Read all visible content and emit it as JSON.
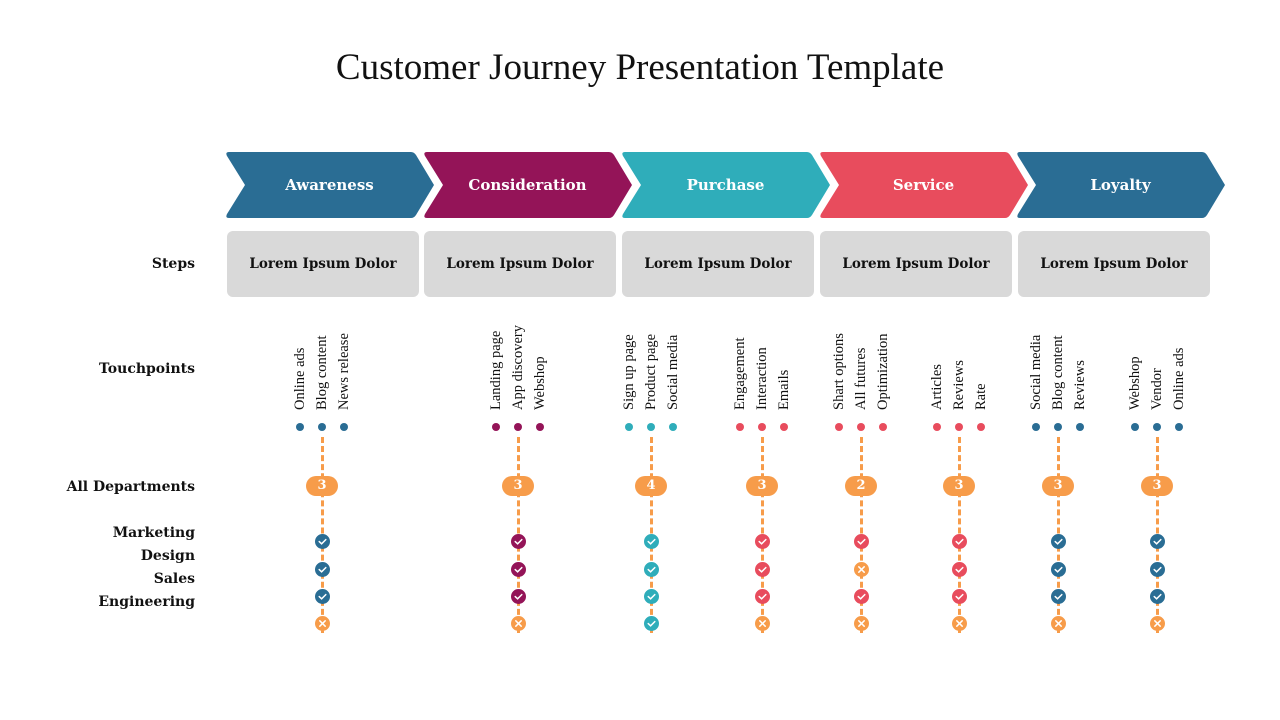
{
  "title": "Customer Journey Presentation Template",
  "colors": {
    "blue": "#2a6d94",
    "magenta": "#941458",
    "teal": "#2fadba",
    "red": "#e84c5d",
    "orange": "#f79c4a",
    "step_bg": "#d9d9d9"
  },
  "row_labels": {
    "steps": "Steps",
    "touchpoints": "Touchpoints",
    "all_departments": "All Departments",
    "departments": [
      "Marketing",
      "Design",
      "Sales",
      "Engineering"
    ]
  },
  "stages": [
    {
      "label": "Awareness",
      "color": "#2a6d94",
      "step": "Lorem Ipsum Dolor"
    },
    {
      "label": "Consideration",
      "color": "#941458",
      "step": "Lorem Ipsum Dolor"
    },
    {
      "label": "Purchase",
      "color": "#2fadba",
      "step": "Lorem Ipsum Dolor"
    },
    {
      "label": "Service",
      "color": "#e84c5d",
      "step": "Lorem Ipsum Dolor"
    },
    {
      "label": "Loyalty",
      "color": "#2a6d94",
      "step": "Lorem Ipsum Dolor"
    }
  ],
  "touchpoint_groups": [
    {
      "color": "#2a6d94",
      "items": [
        "Online ads",
        "Blog content",
        "News release"
      ],
      "count": "3",
      "status": [
        "check",
        "check",
        "check",
        "cross"
      ]
    },
    {
      "color": "#941458",
      "items": [
        "Landing page",
        "App discovery",
        "Webshop"
      ],
      "count": "3",
      "status": [
        "check",
        "check",
        "check",
        "cross"
      ]
    },
    {
      "color": "#2fadba",
      "items": [
        "Sign up page",
        "Product page",
        "Social media"
      ],
      "count": "4",
      "status": [
        "check",
        "check",
        "check",
        "check"
      ]
    },
    {
      "color": "#e84c5d",
      "items": [
        "Engagement",
        "Interaction",
        "Emails"
      ],
      "count": "3",
      "status": [
        "check",
        "check",
        "check",
        "cross"
      ]
    },
    {
      "color": "#e84c5d",
      "items": [
        "Shart options",
        "All futures",
        "Optimization"
      ],
      "count": "2",
      "status": [
        "check",
        "cross",
        "check",
        "cross"
      ]
    },
    {
      "color": "#e84c5d",
      "items": [
        "Articles",
        "Reviews",
        "Rate"
      ],
      "count": "3",
      "status": [
        "check",
        "check",
        "check",
        "cross"
      ]
    },
    {
      "color": "#2a6d94",
      "items": [
        "Social media",
        "Blog content",
        "Reviews"
      ],
      "count": "3",
      "status": [
        "check",
        "check",
        "check",
        "cross"
      ]
    },
    {
      "color": "#2a6d94",
      "items": [
        "Webshop",
        "Vendor",
        "Online ads"
      ],
      "count": "3",
      "status": [
        "check",
        "check",
        "check",
        "cross"
      ]
    }
  ]
}
